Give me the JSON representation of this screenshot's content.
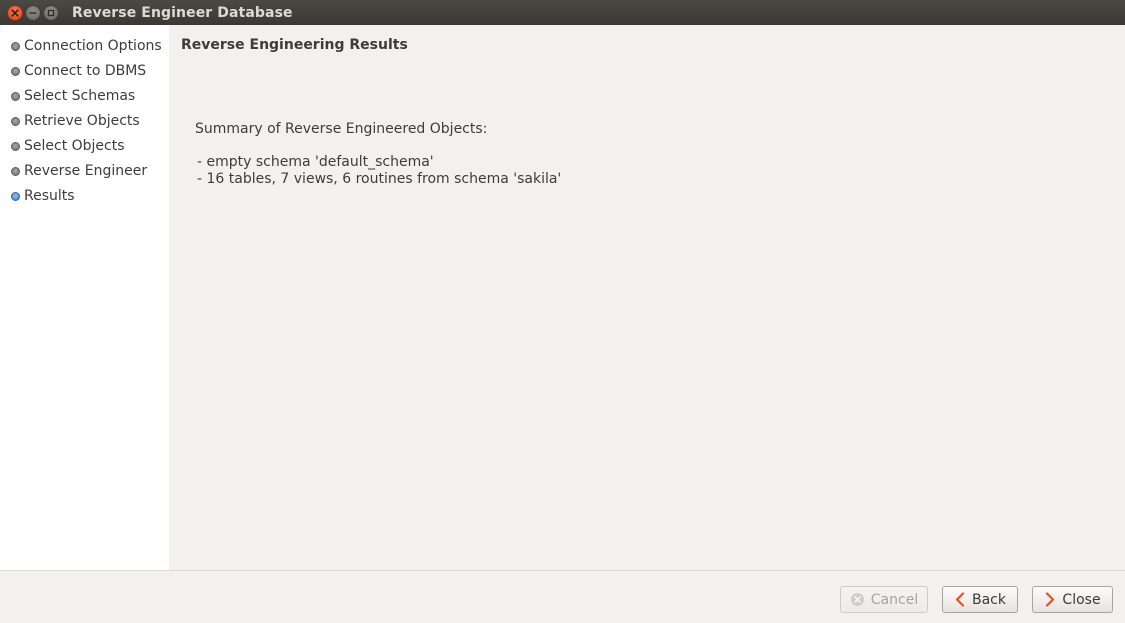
{
  "window": {
    "title": "Reverse Engineer Database"
  },
  "sidebar": {
    "steps": [
      {
        "label": "Connection Options",
        "state": "done"
      },
      {
        "label": "Connect to DBMS",
        "state": "done"
      },
      {
        "label": "Select Schemas",
        "state": "done"
      },
      {
        "label": "Retrieve Objects",
        "state": "done"
      },
      {
        "label": "Select Objects",
        "state": "done"
      },
      {
        "label": "Reverse Engineer",
        "state": "done"
      },
      {
        "label": "Results",
        "state": "current"
      }
    ]
  },
  "main": {
    "title": "Reverse Engineering Results",
    "summary_heading": "Summary of Reverse Engineered Objects:",
    "summary_lines": [
      "- empty schema 'default_schema'",
      "- 16 tables, 7 views, 6 routines from schema 'sakila'"
    ]
  },
  "buttons": {
    "cancel": {
      "label": "Cancel",
      "icon": "cancel-icon",
      "enabled": false
    },
    "back": {
      "label": "Back",
      "icon": "chevron-left-icon",
      "enabled": true
    },
    "close": {
      "label": "Close",
      "icon": "chevron-right-icon",
      "enabled": true
    }
  },
  "colors": {
    "accent_orange": "#e9531e",
    "titlebar": "#3c3b37",
    "current_step_dot": "#4a8fd6"
  }
}
